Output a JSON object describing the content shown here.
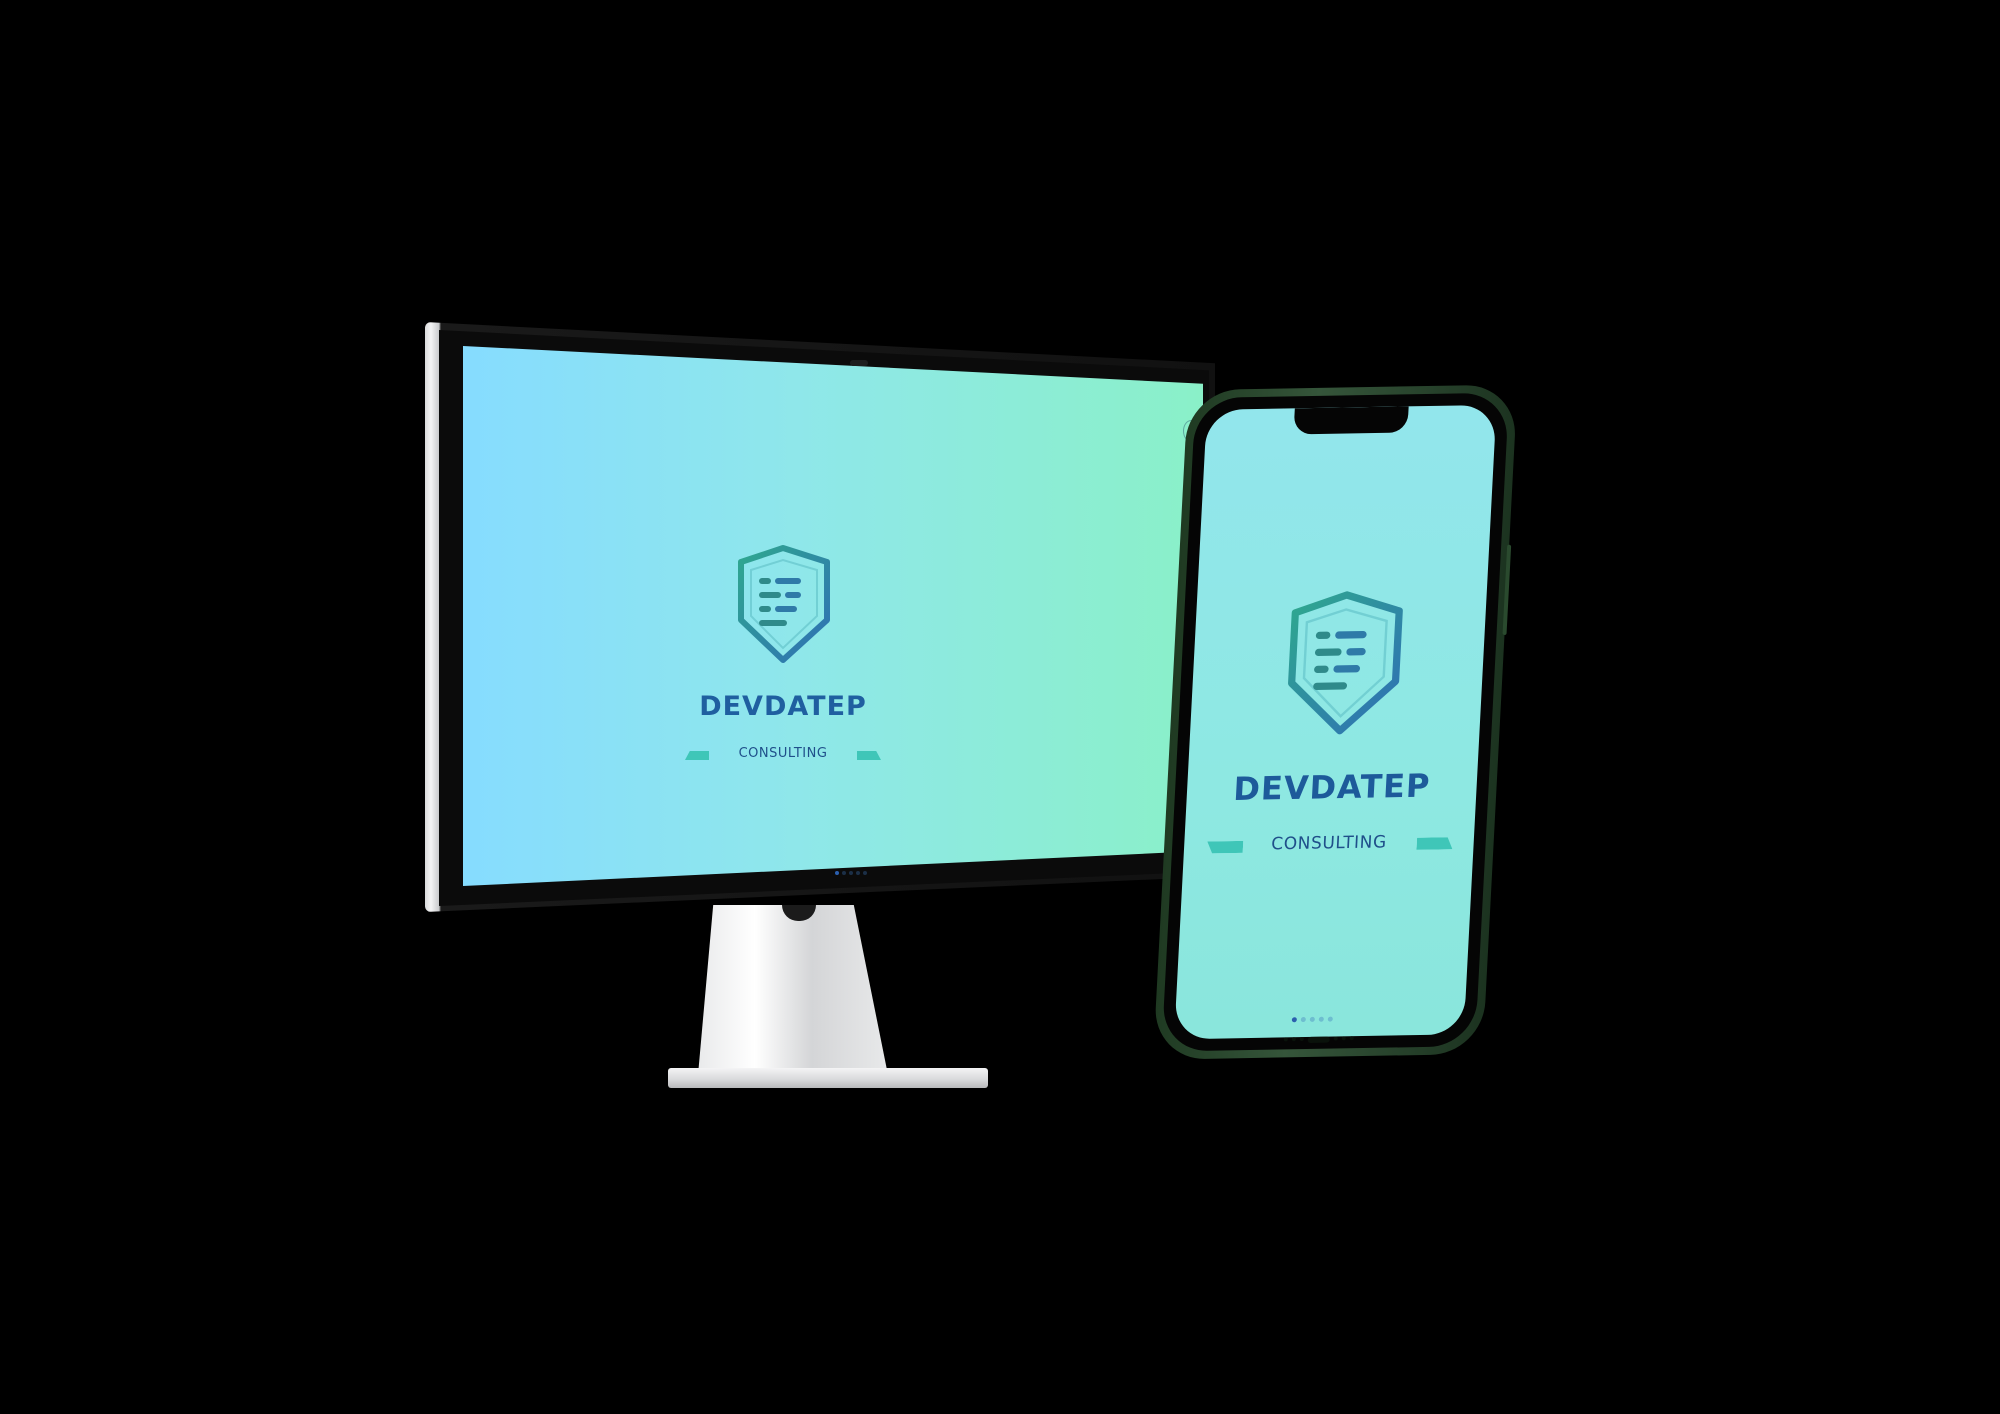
{
  "colors": {
    "background": "#000000",
    "screen_gradient_start": "#86dcff",
    "screen_gradient_end": "#8af0c8",
    "brand_text": "#1f5fa0",
    "accent_bar": "#3fc6b8",
    "logo_stroke_start": "#2fa88f",
    "logo_stroke_end": "#2f6fb5",
    "phone_body": "#2f4f33",
    "stand_silver": "#e4e5e7"
  },
  "monitor": {
    "brand_name": "DEVDATEP",
    "brand_tagline": "CONSULTING",
    "logo_icon": "shield-document-icon",
    "carousel": {
      "count": 5,
      "active_index": 0
    }
  },
  "phone": {
    "brand_name": "DEVDATEP",
    "brand_tagline": "CONSULTING",
    "logo_icon": "shield-document-icon",
    "carousel": {
      "count": 5,
      "active_index": 0
    }
  }
}
